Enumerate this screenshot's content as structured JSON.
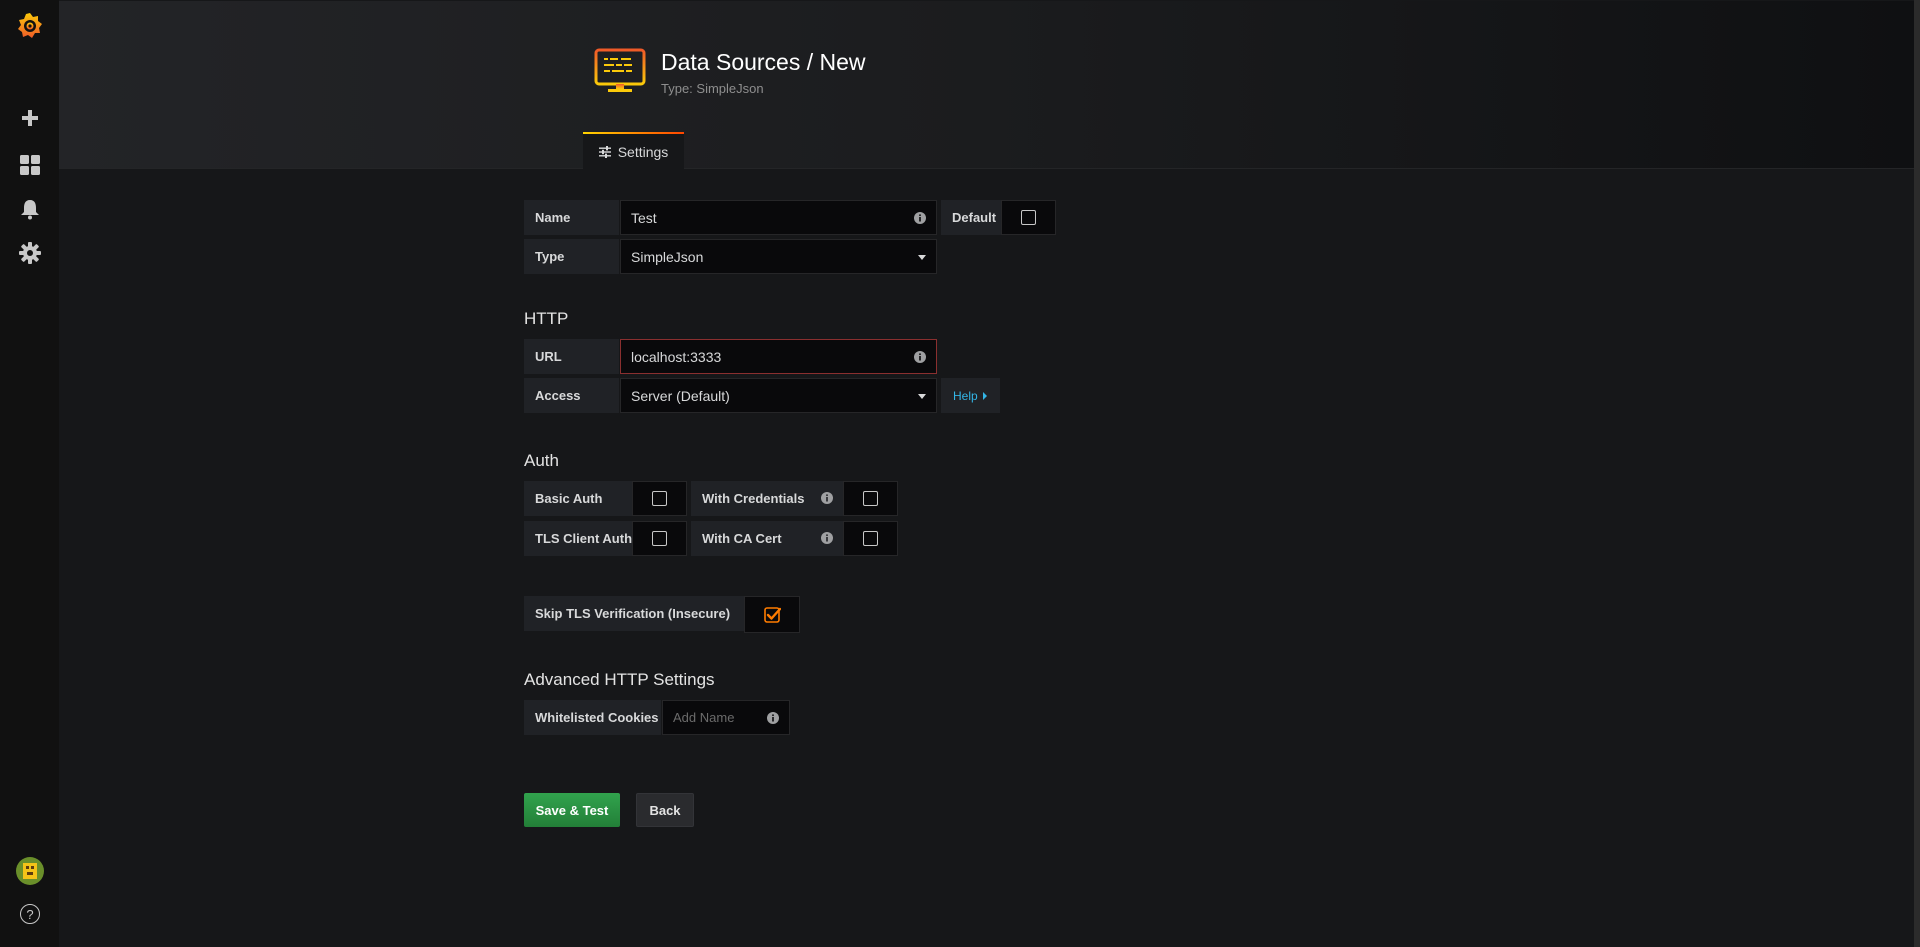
{
  "header": {
    "title": "Data Sources / New",
    "subtitle": "Type: SimpleJson",
    "tab_label": "Settings"
  },
  "sidebar": {
    "icons": [
      "grafana-logo-icon",
      "plus-icon",
      "dashboards-icon",
      "bell-icon",
      "gear-icon"
    ],
    "bottom_icons": [
      "avatar",
      "help-icon"
    ],
    "help_glyph": "?"
  },
  "form": {
    "name": {
      "label": "Name",
      "value": "Test"
    },
    "default": {
      "label": "Default",
      "checked": false
    },
    "type": {
      "label": "Type",
      "value": "SimpleJson"
    }
  },
  "http": {
    "title": "HTTP",
    "url": {
      "label": "URL",
      "value": "localhost:3333"
    },
    "access": {
      "label": "Access",
      "value": "Server (Default)"
    },
    "help_label": "Help"
  },
  "auth": {
    "title": "Auth",
    "basic_auth": {
      "label": "Basic Auth",
      "checked": false
    },
    "with_credentials": {
      "label": "With Credentials",
      "checked": false
    },
    "tls_client_auth": {
      "label": "TLS Client Auth",
      "checked": false
    },
    "with_ca_cert": {
      "label": "With CA Cert",
      "checked": false
    },
    "skip_tls": {
      "label": "Skip TLS Verification (Insecure)",
      "checked": true
    }
  },
  "advanced": {
    "title": "Advanced HTTP Settings",
    "whitelisted_cookies": {
      "label": "Whitelisted Cookies",
      "placeholder": "Add Name"
    }
  },
  "buttons": {
    "save_label": "Save & Test",
    "back_label": "Back"
  },
  "colors": {
    "background": "#161719",
    "sidebar": "#111111",
    "accent_orange": "#ff7c00",
    "save_green": "#299c46",
    "link_blue": "#33b5e5",
    "url_border": "#8a2f2f"
  }
}
